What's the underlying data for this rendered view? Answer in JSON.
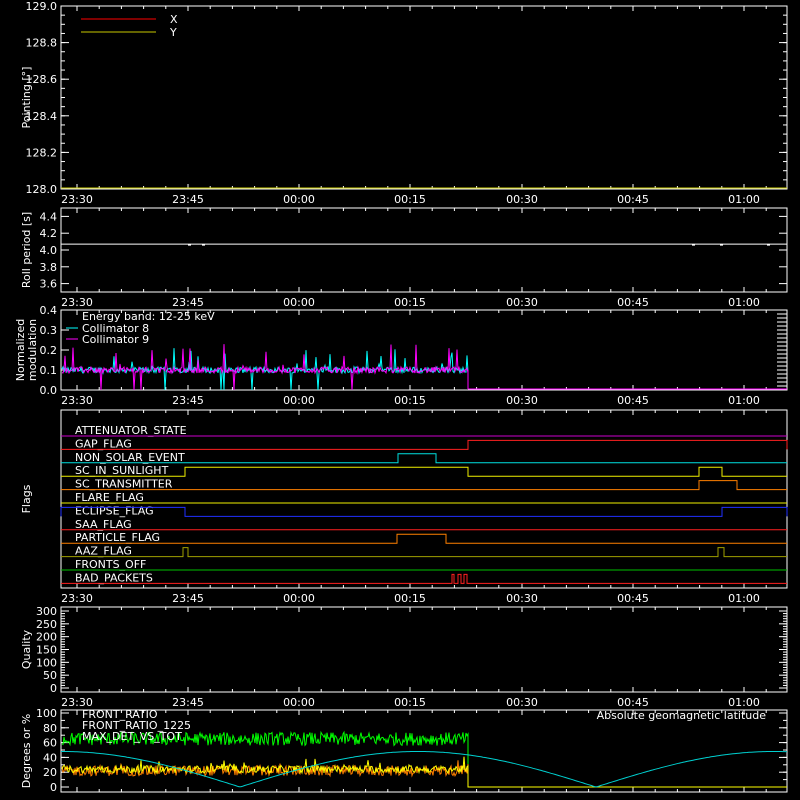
{
  "time_ticks": [
    "23:30",
    "23:45",
    "00:00",
    "00:15",
    "00:30",
    "00:45",
    "01:00"
  ],
  "colors": {
    "X": "#ff0000",
    "Y": "#c8c800"
  },
  "chart_data": [
    {
      "id": "pointing",
      "type": "line",
      "ylabel": "Pointing [°]",
      "ylim": [
        128.0,
        129.0
      ],
      "yticks": [
        "128.0",
        "128.2",
        "128.4",
        "128.6",
        "128.8",
        "129.0"
      ],
      "legend": [
        "X",
        "Y"
      ],
      "series": [
        {
          "name": "X",
          "color": "#ff0000",
          "values": []
        },
        {
          "name": "Y",
          "color": "#c8c800",
          "values": []
        }
      ]
    },
    {
      "id": "roll",
      "type": "line",
      "ylabel": "Roll period [s]",
      "ylim": [
        3.5,
        4.5
      ],
      "yticks": [
        "3.6",
        "3.8",
        "4.0",
        "4.2",
        "4.4"
      ],
      "series": [
        {
          "name": "",
          "color": "#ffffff",
          "x": [
            0,
            1.6
          ],
          "values": [
            4.07,
            4.07
          ]
        }
      ]
    },
    {
      "id": "modulation",
      "type": "line",
      "ylabel": "Normalized modulation",
      "ylim": [
        0.0,
        0.4
      ],
      "yticks": [
        "0.0",
        "0.1",
        "0.2",
        "0.3",
        "0.4"
      ],
      "annotation": "Energy band: 12-25 keV",
      "series": [
        {
          "name": "Collimator 8",
          "color": "#00ffff",
          "mean": 0.1,
          "end_time": "00:24"
        },
        {
          "name": "Collimator 9",
          "color": "#ff00ff",
          "mean": 0.1,
          "end_time": "00:24"
        }
      ]
    },
    {
      "id": "flags",
      "type": "line",
      "ylabel": "Flags",
      "flags": [
        {
          "label": "ATTENUATOR_STATE",
          "color": "#cc00cc"
        },
        {
          "label": "GAP_FLAG",
          "color": "#ff2020"
        },
        {
          "label": "NON_SOLAR_EVENT",
          "color": "#00e0e0"
        },
        {
          "label": "SC_IN_SUNLIGHT",
          "color": "#f0f000"
        },
        {
          "label": "SC_TRANSMITTER",
          "color": "#ff8000"
        },
        {
          "label": "FLARE_FLAG",
          "color": "#f0f000"
        },
        {
          "label": "ECLIPSE_FLAG",
          "color": "#2030ff"
        },
        {
          "label": "SAA_FLAG",
          "color": "#ff2020"
        },
        {
          "label": "PARTICLE_FLAG",
          "color": "#ff8000"
        },
        {
          "label": "AAZ_FLAG",
          "color": "#a0a000"
        },
        {
          "label": "FRONTS_OFF",
          "color": "#00c000"
        },
        {
          "label": "BAD_PACKETS",
          "color": "#ff2020"
        }
      ]
    },
    {
      "id": "quality",
      "type": "line",
      "ylabel": "Quality",
      "ylim": [
        0,
        300
      ],
      "yticks": [
        "0",
        "50",
        "100",
        "150",
        "200",
        "250",
        "300"
      ],
      "series": []
    },
    {
      "id": "ratios",
      "type": "line",
      "ylabel": "Degrees or %",
      "ylim": [
        0,
        100
      ],
      "yticks": [
        "0",
        "20",
        "40",
        "60",
        "80",
        "100"
      ],
      "annotation": "Absolute geomagnetic latitude",
      "series": [
        {
          "name": "FRONT_RATIO",
          "color": "#ffff00"
        },
        {
          "name": "FRONT_RATIO_1225",
          "color": "#00ff00"
        },
        {
          "name": "MAX_DET_VS_TOT",
          "color": "#ff8000"
        },
        {
          "name": "Absolute geomagnetic latitude",
          "color": "#00d0d0"
        }
      ]
    }
  ]
}
